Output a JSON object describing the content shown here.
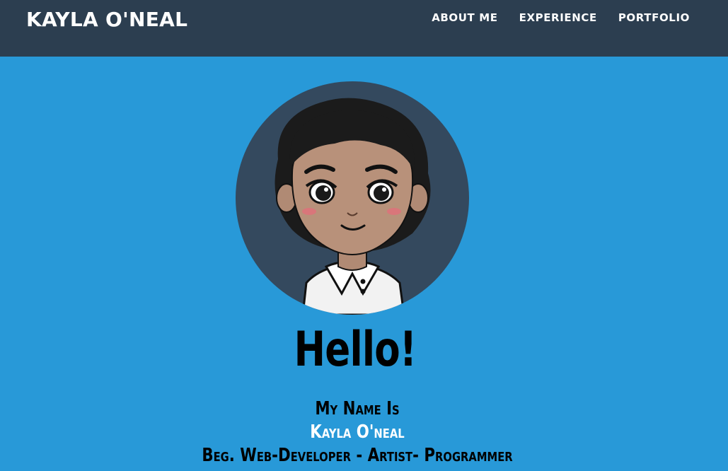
{
  "header": {
    "brand": "KAYLA O'NEAL",
    "nav": [
      {
        "label": "ABOUT ME"
      },
      {
        "label": "EXPERIENCE"
      },
      {
        "label": "PORTFOLIO"
      }
    ]
  },
  "hero": {
    "greeting": "Hello!",
    "line1": "My Name Is",
    "line2": "Kayla O'neal",
    "line3": "Beg. Web-Developer - Artist- Programmer"
  },
  "colors": {
    "navbar": "#2c3e50",
    "background": "#2899d8",
    "avatar_circle": "#34495e"
  }
}
